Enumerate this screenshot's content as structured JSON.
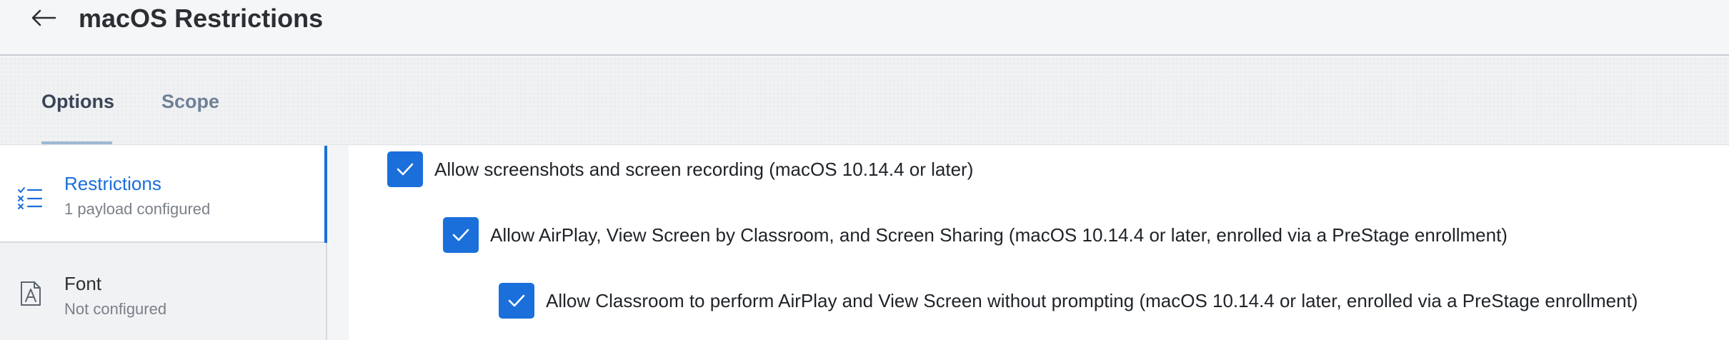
{
  "header": {
    "title": "macOS Restrictions"
  },
  "tabs": [
    {
      "label": "Options",
      "active": true
    },
    {
      "label": "Scope",
      "active": false
    }
  ],
  "sidebar": {
    "items": [
      {
        "label": "Restrictions",
        "status": "1 payload configured",
        "icon": "checklist-icon",
        "active": true
      },
      {
        "label": "Font",
        "status": "Not configured",
        "icon": "font-file-icon",
        "active": false
      }
    ]
  },
  "options": [
    {
      "label": "Allow screenshots and screen recording (macOS 10.14.4 or later)",
      "checked": true
    },
    {
      "label": "Allow AirPlay, View Screen by Classroom, and Screen Sharing (macOS 10.14.4 or later, enrolled via a PreStage enrollment)",
      "checked": true
    },
    {
      "label": "Allow Classroom to perform AirPlay and View Screen without prompting (macOS 10.14.4 or later, enrolled via a PreStage enrollment)",
      "checked": true
    }
  ],
  "colors": {
    "accent": "#1a6fdb",
    "active_tab_underline": "#9db8d3"
  }
}
